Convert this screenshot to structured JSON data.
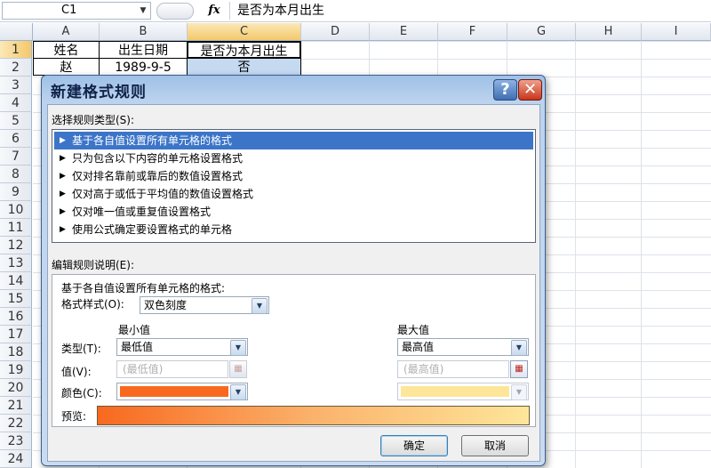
{
  "formula_bar": {
    "name_box": "C1",
    "fx": "fx",
    "formula": "是否为本月出生"
  },
  "columns": [
    "A",
    "B",
    "C",
    "D",
    "E",
    "F",
    "G",
    "H",
    "I"
  ],
  "rows": [
    "1",
    "2",
    "3",
    "4",
    "5",
    "6",
    "7",
    "8",
    "9",
    "10",
    "11",
    "12",
    "13",
    "14",
    "15",
    "16",
    "17",
    "18",
    "19",
    "20",
    "21",
    "22",
    "23",
    "24",
    "25"
  ],
  "cells": {
    "a1": "姓名",
    "b1": "出生日期",
    "c1": "是否为本月出生",
    "a2": "赵",
    "b2": "1989-9-5",
    "c2": "否"
  },
  "dialog": {
    "title": "新建格式规则",
    "help": "?",
    "close": "✕",
    "select_type_label": "选择规则类型(S):",
    "rule_types": [
      "基于各自值设置所有单元格的格式",
      "只为包含以下内容的单元格设置格式",
      "仅对排名靠前或靠后的数值设置格式",
      "仅对高于或低于平均值的数值设置格式",
      "仅对唯一值或重复值设置格式",
      "使用公式确定要设置格式的单元格"
    ],
    "edit_desc_label": "编辑规则说明(E):",
    "desc_heading": "基于各自值设置所有单元格的格式:",
    "format_style_label": "格式样式(O):",
    "format_style_value": "双色刻度",
    "min_heading": "最小值",
    "max_heading": "最大值",
    "type_label": "类型(T):",
    "value_label": "值(V):",
    "color_label": "颜色(C):",
    "min_type": "最低值",
    "max_type": "最高值",
    "min_value_placeholder": "(最低值)",
    "max_value_placeholder": "(最高值)",
    "min_color": "#f8691f",
    "max_color": "#fde69a",
    "preview_label": "预览:",
    "ok": "确定",
    "cancel": "取消"
  }
}
